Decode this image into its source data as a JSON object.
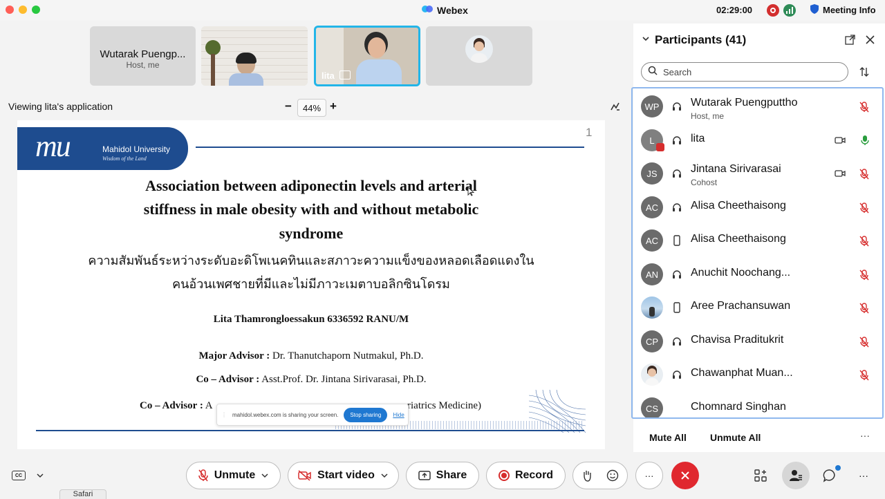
{
  "app": {
    "title": "Webex",
    "timer": "02:29:00",
    "meeting_info": "Meeting Info"
  },
  "thumbnails": [
    {
      "name": "Wutarak Puengp...",
      "role": "Host, me"
    },
    {
      "name": "",
      "role": ""
    },
    {
      "name": "lita",
      "role": ""
    },
    {
      "name": "",
      "role": ""
    }
  ],
  "share": {
    "viewing_label": "Viewing lita's application",
    "zoom": "44%",
    "minus": "−",
    "plus": "+"
  },
  "slide": {
    "page_number": "1",
    "logo_script": "mu",
    "logo_name": "Mahidol University",
    "logo_tagline": "Wisdom of the Land",
    "title_line1": "Association between adiponectin levels and arterial",
    "title_line2": "stiffness in male obesity with and without metabolic",
    "title_line3": "syndrome",
    "thai_line1": "ความสัมพันธ์ระหว่างระดับอะดิโพเนคทินและสภาวะความแข็งของหลอดเลือดแดงใน",
    "thai_line2": "คนอ้วนเพศชายที่มีและไม่มีภาวะเมตาบอลิกซินโดรม",
    "author": "Lita Thamrongloessakun 6336592 RANU/M",
    "major_label": "Major Advisor :",
    "major_value": "Dr. Thanutchaporn Nutmakul, Ph.D.",
    "co1_label": "Co – Advisor :",
    "co1_value": "Asst.Prof. Dr. Jintana Sirivarasai, Ph.D.",
    "co2_label": "Co – Advisor :",
    "co2_prefix": "A",
    "co2_suffix": "riatrics Medicine)"
  },
  "sharing_banner": {
    "text": "mahidol.webex.com is sharing your screen.",
    "stop": "Stop sharing",
    "hide": "Hide"
  },
  "participants": {
    "title": "Participants (41)",
    "search_placeholder": "Search",
    "mute_all": "Mute All",
    "unmute_all": "Unmute All",
    "items": [
      {
        "initials": "WP",
        "name": "Wutarak Puengputtho",
        "sub": "Host, me",
        "device": "headset",
        "video": false,
        "mic": "muted"
      },
      {
        "initials": "L",
        "name": "lita",
        "sub": "",
        "device": "headset",
        "video": true,
        "mic": "active"
      },
      {
        "initials": "JS",
        "name": "Jintana Sirivarasai",
        "sub": "Cohost",
        "device": "headset",
        "video": true,
        "mic": "muted"
      },
      {
        "initials": "AC",
        "name": "Alisa Cheethaisong",
        "sub": "",
        "device": "headset",
        "video": false,
        "mic": "muted"
      },
      {
        "initials": "AC",
        "name": "Alisa Cheethaisong",
        "sub": "",
        "device": "phone",
        "video": false,
        "mic": "muted"
      },
      {
        "initials": "AN",
        "name": "Anuchit Noochang...",
        "sub": "",
        "device": "headset",
        "video": false,
        "mic": "muted"
      },
      {
        "initials": "",
        "name": "Aree Prachansuwan",
        "sub": "",
        "device": "phone",
        "video": false,
        "mic": "muted"
      },
      {
        "initials": "CP",
        "name": "Chavisa Praditukrit",
        "sub": "",
        "device": "headset",
        "video": false,
        "mic": "muted"
      },
      {
        "initials": "",
        "name": "Chawanphat Muan...",
        "sub": "",
        "device": "headset",
        "video": false,
        "mic": "muted"
      },
      {
        "initials": "CS",
        "name": "Chomnard Singhan",
        "sub": "",
        "device": "",
        "video": false,
        "mic": ""
      }
    ]
  },
  "controls": {
    "unmute": "Unmute",
    "start_video": "Start video",
    "share": "Share",
    "record": "Record",
    "more": "···"
  },
  "dock": {
    "tooltip": "Safari"
  },
  "colors": {
    "accent": "#1f78d1",
    "end_call": "#e0282f",
    "muted_red": "#d62d2d",
    "mic_green": "#2a9d3e",
    "slide_blue": "#1e4c8f"
  }
}
